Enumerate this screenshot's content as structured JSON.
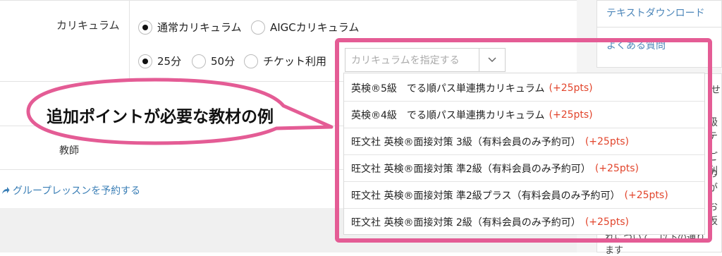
{
  "form": {
    "curriculum_label": "カリキュラム",
    "curriculum_options": [
      {
        "label": "通常カリキュラム",
        "selected": true
      },
      {
        "label": "AIGCカリキュラム",
        "selected": false
      }
    ],
    "duration_options": [
      {
        "label": "25分",
        "selected": true
      },
      {
        "label": "50分",
        "selected": false
      },
      {
        "label": "チケット利用",
        "selected": false
      }
    ],
    "select_placeholder": "カリキュラムを指定する",
    "teacher_label": "教師",
    "group_lesson_link": "グループレッスンを予約する"
  },
  "dropdown": {
    "options": [
      {
        "text": "英検®5級　でる順パス単連携カリキュラム",
        "pts": "(+25pts)"
      },
      {
        "text": "英検®4級　でる順パス単連携カリキュラム",
        "pts": "(+25pts)"
      },
      {
        "text": "旺文社 英検®面接対策 3級（有料会員のみ予約可）",
        "pts": "(+25pts)"
      },
      {
        "text": "旺文社 英検®面接対策 準2級（有料会員のみ予約可）",
        "pts": "(+25pts)"
      },
      {
        "text": "旺文社 英検®面接対策 準2級プラス（有料会員のみ予約可）",
        "pts": "(+25pts)"
      },
      {
        "text": "旺文社 英検®面接対策 2級（有料会員のみ予約可）",
        "pts": "(+25pts)"
      }
    ]
  },
  "annotation": {
    "bubble_text": "追加ポイントが必要な教材の例"
  },
  "sidebar": {
    "links": [
      "テキストダウンロード",
      "よくある質問"
    ],
    "fragments": [
      "せ",
      "級テ",
      "ご利",
      "のが",
      "お坂",
      "れについて、以下の通り",
      "ます"
    ]
  },
  "colors": {
    "frame": "#e45c95",
    "points": "#e2452c",
    "link": "#4c86b9"
  }
}
